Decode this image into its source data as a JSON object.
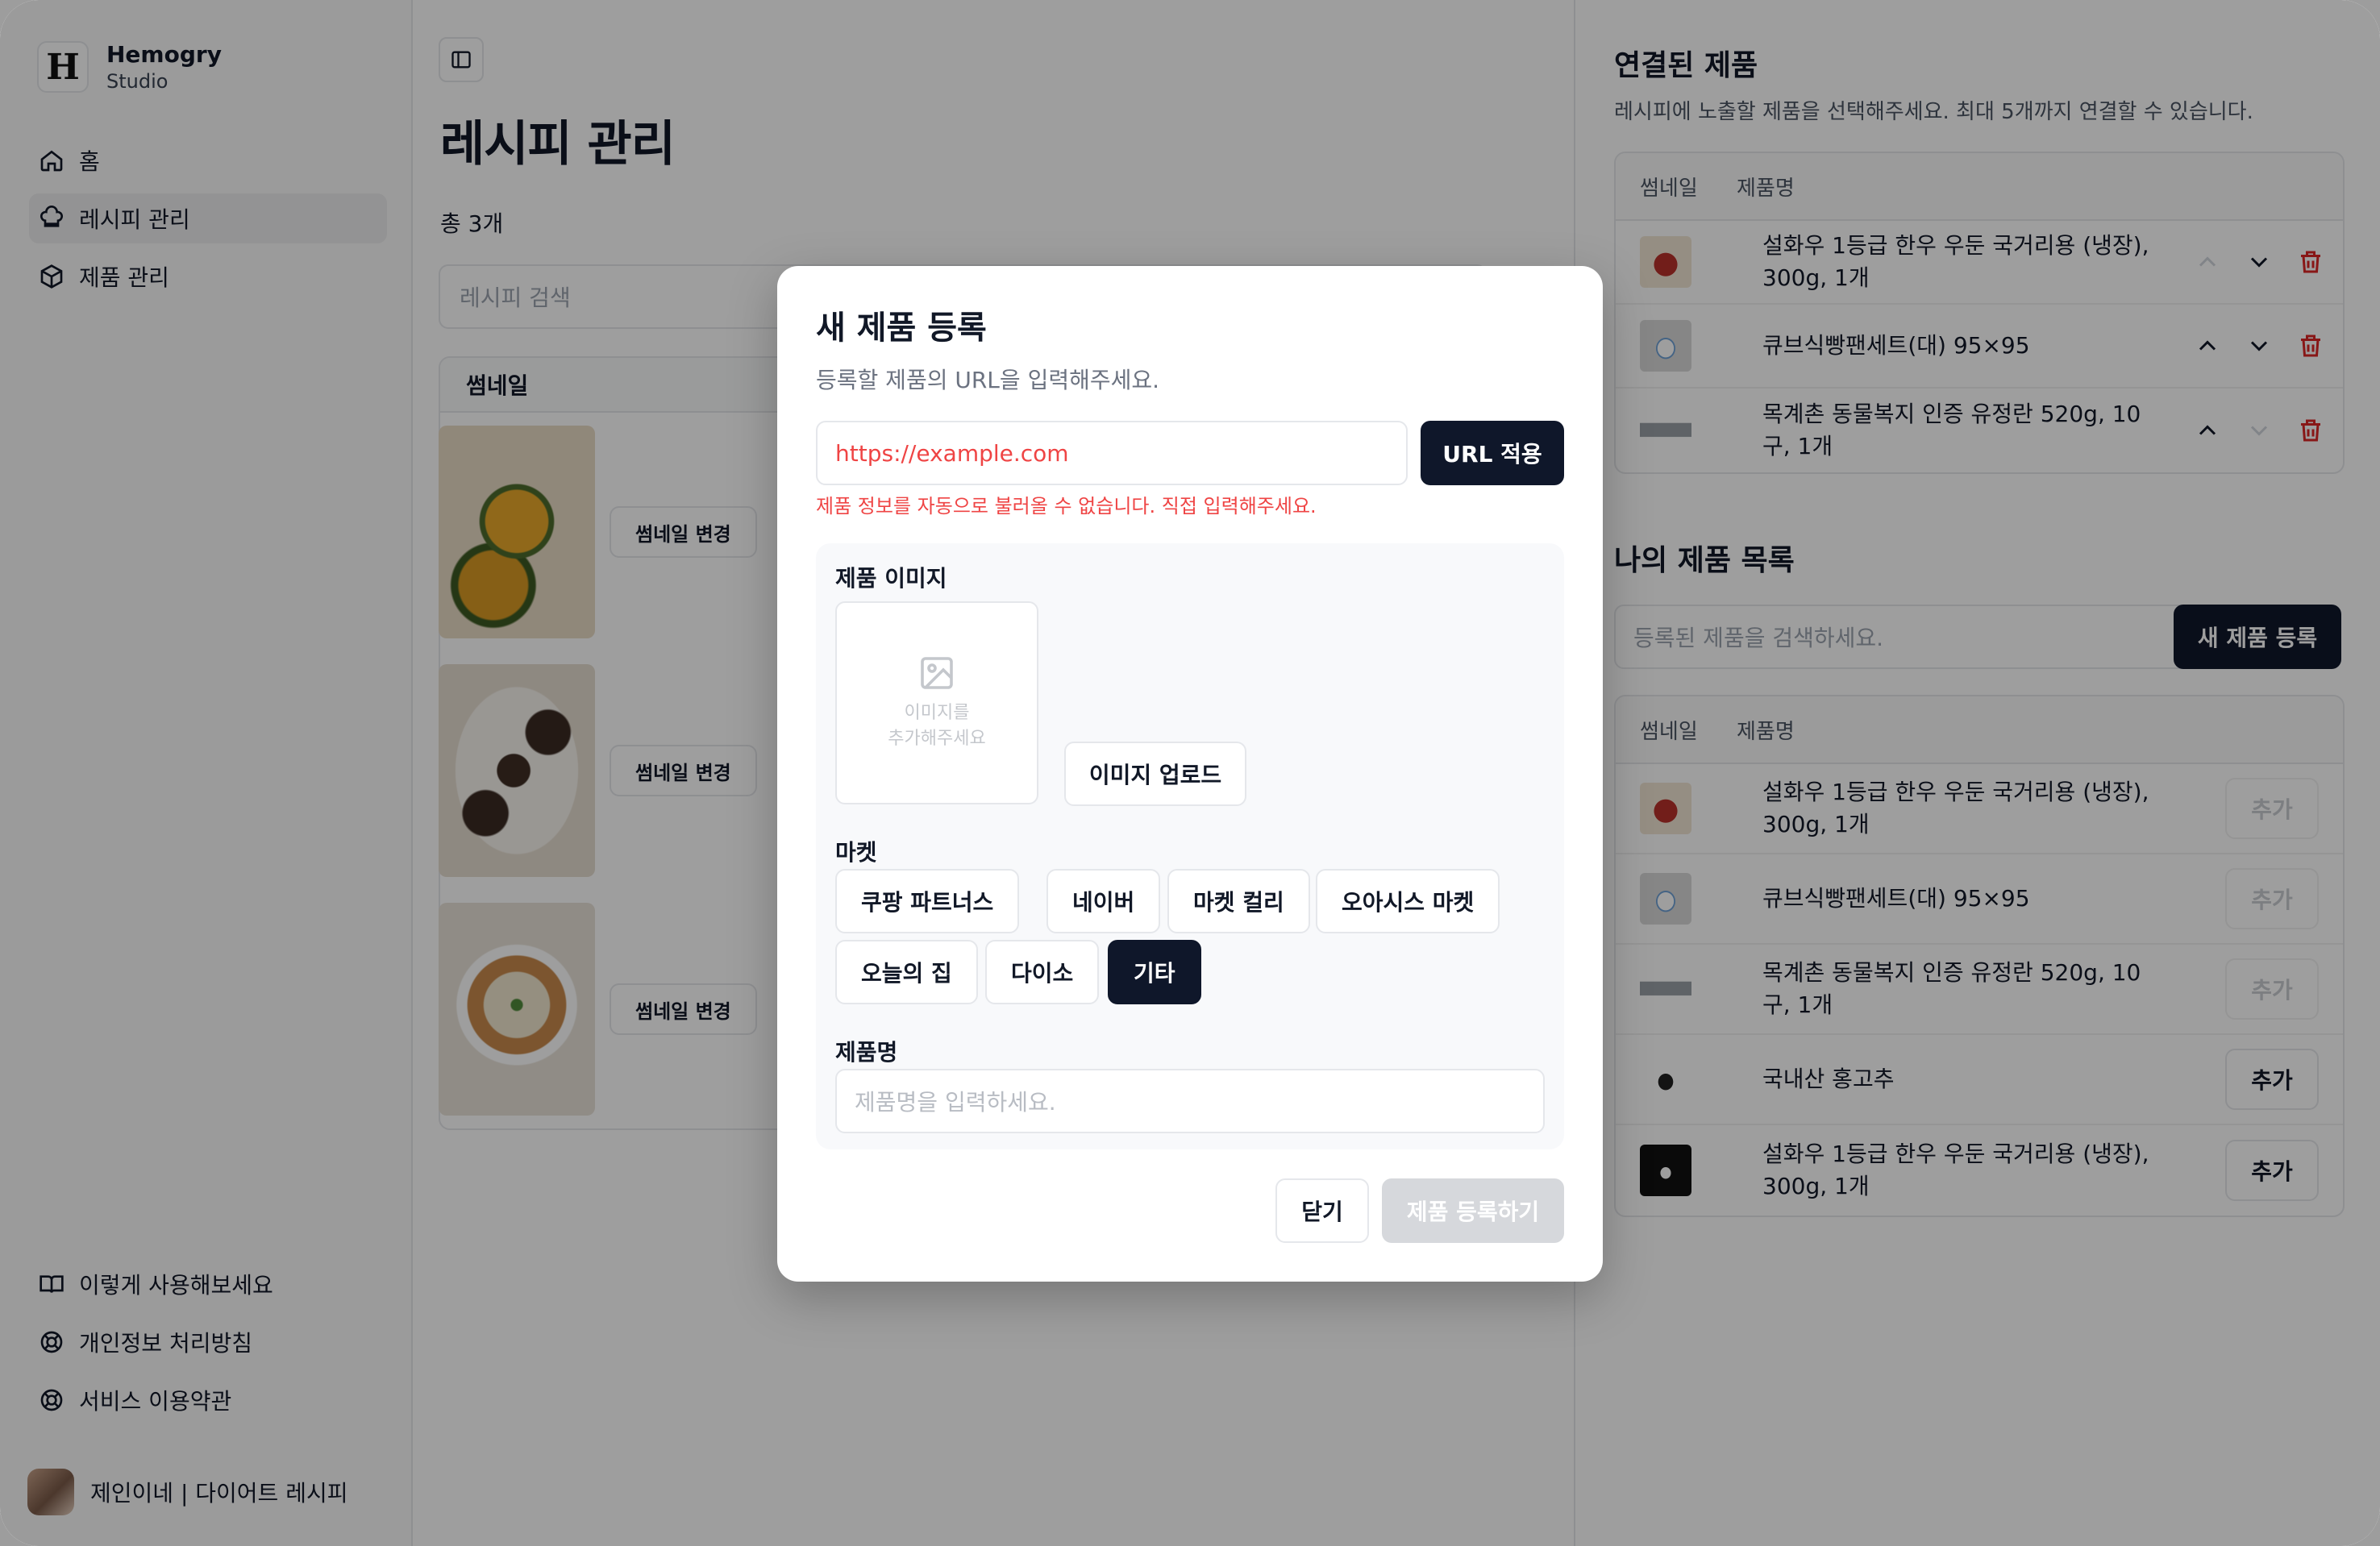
{
  "brand": {
    "logo_letter": "H",
    "name": "Hemogry",
    "sub": "Studio"
  },
  "sidebar": {
    "nav": [
      {
        "label": "홈",
        "icon": "home-icon"
      },
      {
        "label": "레시피 관리",
        "icon": "chef-hat-icon"
      },
      {
        "label": "제품 관리",
        "icon": "box-icon"
      }
    ],
    "footer": [
      {
        "label": "이렇게 사용해보세요",
        "icon": "book-icon"
      },
      {
        "label": "개인정보 처리방침",
        "icon": "lifebuoy-icon"
      },
      {
        "label": "서비스 이용약관",
        "icon": "lifebuoy-icon"
      }
    ],
    "user": "제인이네 | 다이어트 레시피"
  },
  "main": {
    "title": "레시피 관리",
    "count": "총 3개",
    "search_placeholder": "레시피 검색",
    "table_header": "썸네일",
    "change_thumb_label": "썸네일 변경"
  },
  "right": {
    "linked_title": "연결된 제품",
    "linked_desc": "레시피에 노출할 제품을 선택해주세요. 최대 5개까지 연결할 수 있습니다.",
    "col_thumb": "썸네일",
    "col_name": "제품명",
    "linked_items": [
      {
        "name": "설화우 1등급 한우 우둔 국거리용 (냉장), 300g, 1개"
      },
      {
        "name": "큐브식빵팬세트(대) 95×95"
      },
      {
        "name": "목계촌 동물복지 인증 유정란 520g, 10구, 1개"
      }
    ],
    "mine_title": "나의 제품 목록",
    "mine_search_placeholder": "등록된 제품을 검색하세요.",
    "new_button": "새 제품 등록",
    "add_label": "추가",
    "mine_items": [
      {
        "name": "설화우 1등급 한우 우둔 국거리용 (냉장), 300g, 1개",
        "added": true
      },
      {
        "name": "큐브식빵팬세트(대) 95×95",
        "added": true
      },
      {
        "name": "목계촌 동물복지 인증 유정란 520g, 10구, 1개",
        "added": true
      },
      {
        "name": "국내산 홍고추",
        "added": false
      },
      {
        "name": "설화우 1등급 한우 우둔 국거리용 (냉장), 300g, 1개",
        "added": false
      }
    ]
  },
  "modal": {
    "title": "새 제품 등록",
    "desc": "등록할 제품의 URL을 입력해주세요.",
    "url_value": "https://example.com",
    "url_button": "URL 적용",
    "error": "제품 정보를 자동으로 불러올 수 없습니다. 직접 입력해주세요.",
    "image_label": "제품 이미지",
    "image_placeholder_1": "이미지를",
    "image_placeholder_2": "추가해주세요",
    "upload_button": "이미지 업로드",
    "market_label": "마켓",
    "markets": [
      "쿠팡 파트너스",
      "네이버",
      "마켓 컬리",
      "오아시스 마켓",
      "오늘의 집",
      "다이소",
      "기타"
    ],
    "selected_market": "기타",
    "name_label": "제품명",
    "name_placeholder": "제품명을 입력하세요.",
    "close_button": "닫기",
    "submit_button": "제품 등록하기"
  },
  "colors": {
    "primary": "#0f172a",
    "error": "#ef4444",
    "delete": "#dc2626"
  }
}
